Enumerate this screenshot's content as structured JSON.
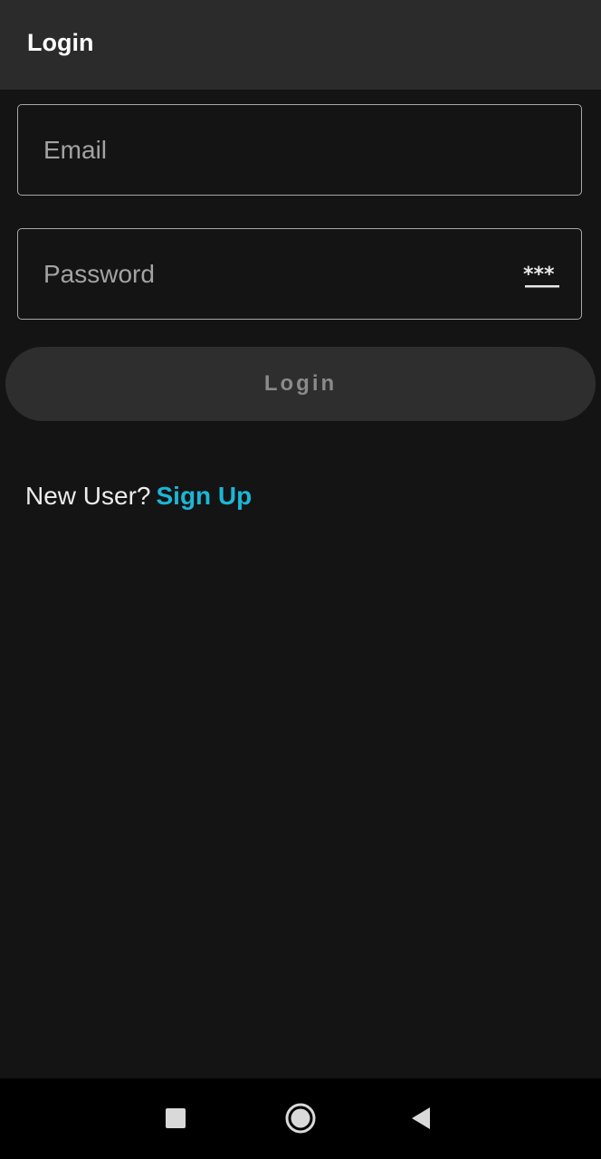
{
  "app_bar": {
    "title": "Login"
  },
  "form": {
    "email": {
      "placeholder": "Email",
      "value": ""
    },
    "password": {
      "placeholder": "Password",
      "value": "",
      "toggle_icon": "password-visibility-icon"
    },
    "login_button_label": "Login"
  },
  "signup": {
    "prompt": "New User?",
    "link_label": "Sign Up"
  },
  "nav_bar": {
    "icons": [
      "recents-square-icon",
      "home-circle-icon",
      "back-triangle-icon"
    ]
  },
  "colors": {
    "background": "#141414",
    "app_bar": "#2b2b2b",
    "field_border": "#a8a8a8",
    "button_bg": "#2e2e2e",
    "button_text": "#8a8a8a",
    "link": "#1cb6d6",
    "nav_bar": "#000000"
  }
}
